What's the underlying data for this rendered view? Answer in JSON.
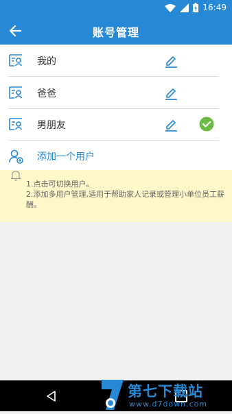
{
  "status_bar": {
    "time": "16:49"
  },
  "app_bar": {
    "title": "账号管理"
  },
  "accounts": [
    {
      "name": "我的",
      "active": false
    },
    {
      "name": "爸爸",
      "active": false
    },
    {
      "name": "男朋友",
      "active": true
    }
  ],
  "add_user_label": "添加一个用户",
  "notice": {
    "line1": "1.点击可切换用户。",
    "line2": "2.添加多用户管理,适用于帮助家人记录或管理小单位员工薪酬。"
  },
  "watermark": {
    "title": "第七下载站",
    "url": "www.d7down.com"
  },
  "colors": {
    "primary": "#2789d6",
    "check": "#6dbb45",
    "notice_bg": "#fdf7c9"
  }
}
